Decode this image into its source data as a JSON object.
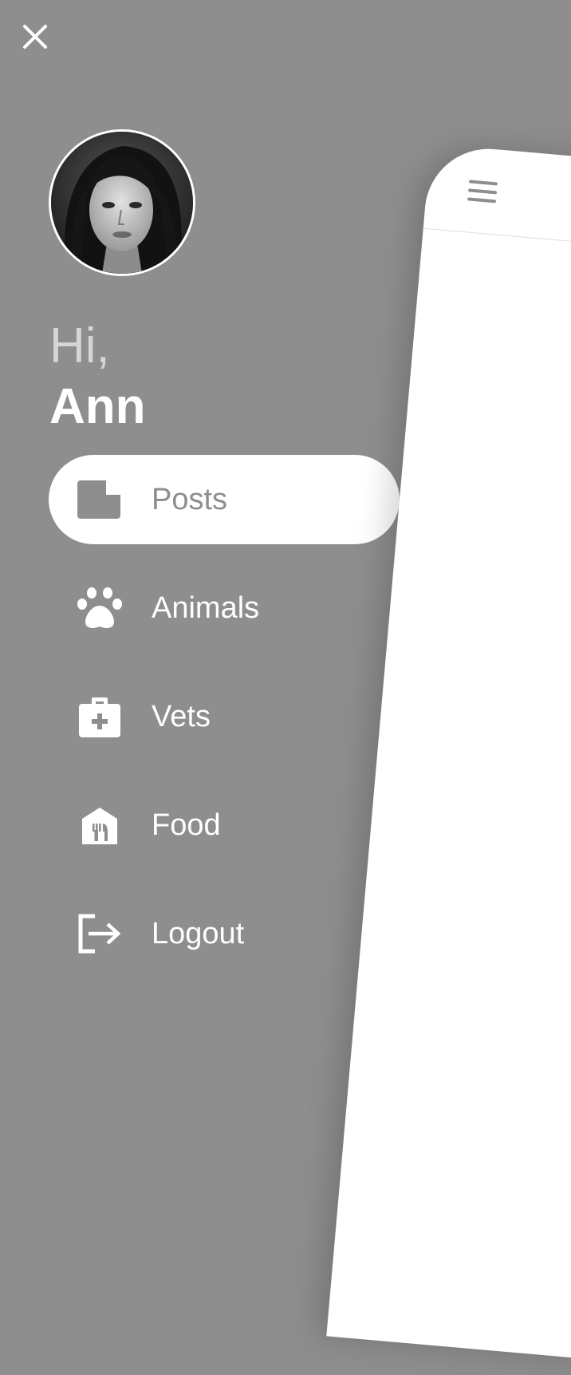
{
  "drawer": {
    "greeting": "Hi,",
    "username": "Ann",
    "menu": [
      {
        "label": "Posts",
        "icon": "document-icon",
        "active": true
      },
      {
        "label": "Animals",
        "icon": "paw-icon",
        "active": false
      },
      {
        "label": "Vets",
        "icon": "medical-bag-icon",
        "active": false
      },
      {
        "label": "Food",
        "icon": "food-store-icon",
        "active": false
      },
      {
        "label": "Logout",
        "icon": "logout-icon",
        "active": false
      }
    ]
  },
  "colors": {
    "drawer_background": "#8e8e8e",
    "active_pill": "#ffffff",
    "icon_inactive": "#ffffff",
    "icon_active": "#8e8e8e"
  }
}
